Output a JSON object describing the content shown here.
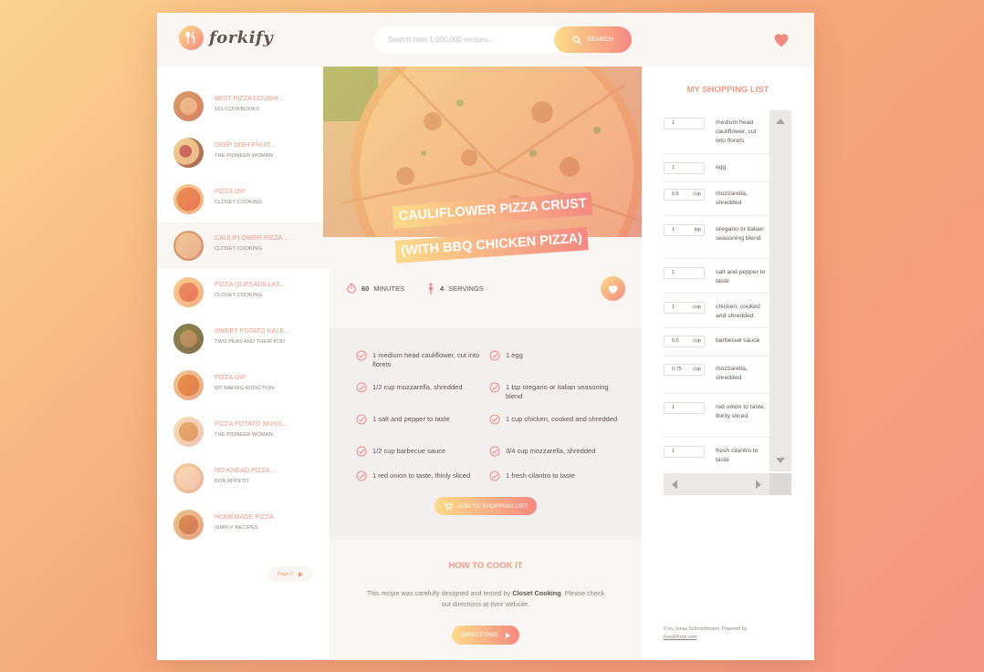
{
  "header": {
    "logo_text": "forkify",
    "search_placeholder": "Search over 1,000,000 recipes...",
    "search_button": "Search"
  },
  "results": [
    {
      "title": "BEST PIZZA DOUGH...",
      "author": "101 COOKBOOKS"
    },
    {
      "title": "DEEP DISH FRUIT...",
      "author": "THE PIONEER WOMAN"
    },
    {
      "title": "PIZZA DIP",
      "author": "CLOSET COOKING"
    },
    {
      "title": "CAULIFLOWER PIZZA...",
      "author": "CLOSET COOKING"
    },
    {
      "title": "PIZZA QUESADILLAS...",
      "author": "CLOSET COOKING"
    },
    {
      "title": "SWEET POTATO KALE...",
      "author": "TWO PEAS AND THEIR POD"
    },
    {
      "title": "PIZZA DIP",
      "author": "MY BAKING ADDICTION"
    },
    {
      "title": "PIZZA POTATO SKINS...",
      "author": "THE PIONEER WOMAN"
    },
    {
      "title": "NO-KNEAD PIZZA...",
      "author": "BON APPETIT"
    },
    {
      "title": "HOMEMADE PIZZA",
      "author": "SIMPLY RECIPES"
    }
  ],
  "pagination": {
    "label": "Page 2"
  },
  "recipe": {
    "title_line1": "CAULIFLOWER PIZZA CRUST",
    "title_line2": "(WITH BBQ CHICKEN PIZZA)",
    "time_value": "60",
    "time_unit": "MINUTES",
    "servings_value": "4",
    "servings_unit": "SERVINGS",
    "ingredients": [
      "1 medium head cauliflower, cut into florets",
      "1 egg",
      "1/2 cup mozzarella, shredded",
      "1 tsp oregano or italian seasoning blend",
      "1 salt and pepper to taste",
      "1 cup chicken, cooked and shredded",
      "1/2 cup barbecue sauce",
      "3/4 cup mozzarella, shredded",
      "1 red onion to taste, thinly sliced",
      "1 fresh cilantro to taste"
    ],
    "add_to_list": "ADD TO SHOPPING LIST",
    "directions_heading": "HOW TO COOK IT",
    "directions_text_1": "This recipe was carefully designed and tested by ",
    "directions_publisher": "Closet Cooking",
    "directions_text_2": ". Please check out directions at their website.",
    "directions_button": "DIRECTIONS"
  },
  "shopping": {
    "title": "MY SHOPPING LIST",
    "items": [
      {
        "count": "1",
        "unit": "",
        "desc": "medium head cauliflower, cut into florets"
      },
      {
        "count": "1",
        "unit": "",
        "desc": "egg"
      },
      {
        "count": "0.5",
        "unit": "cup",
        "desc": "mozzarella, shredded"
      },
      {
        "count": "1",
        "unit": "tsp",
        "desc": "oregano or italian seasoning blend"
      },
      {
        "count": "1",
        "unit": "",
        "desc": "salt and pepper to taste"
      },
      {
        "count": "1",
        "unit": "cup",
        "desc": "chicken, cooked and shredded"
      },
      {
        "count": "0.5",
        "unit": "cup",
        "desc": "barbecue sauce"
      },
      {
        "count": "0.75",
        "unit": "cup",
        "desc": "mozzarella, shredded"
      },
      {
        "count": "1",
        "unit": "",
        "desc": "red onion to taste, thinly sliced"
      },
      {
        "count": "1",
        "unit": "",
        "desc": "fresh cilantro to taste"
      }
    ]
  },
  "footer": {
    "copyright": "© by Jonas Schmedtmann. Powered by",
    "link": "Food2Fork.com"
  },
  "colors": {
    "accent_start": "#fbdb89",
    "accent_end": "#f48982",
    "text": "#615551",
    "accent_text": "#f59a83"
  }
}
